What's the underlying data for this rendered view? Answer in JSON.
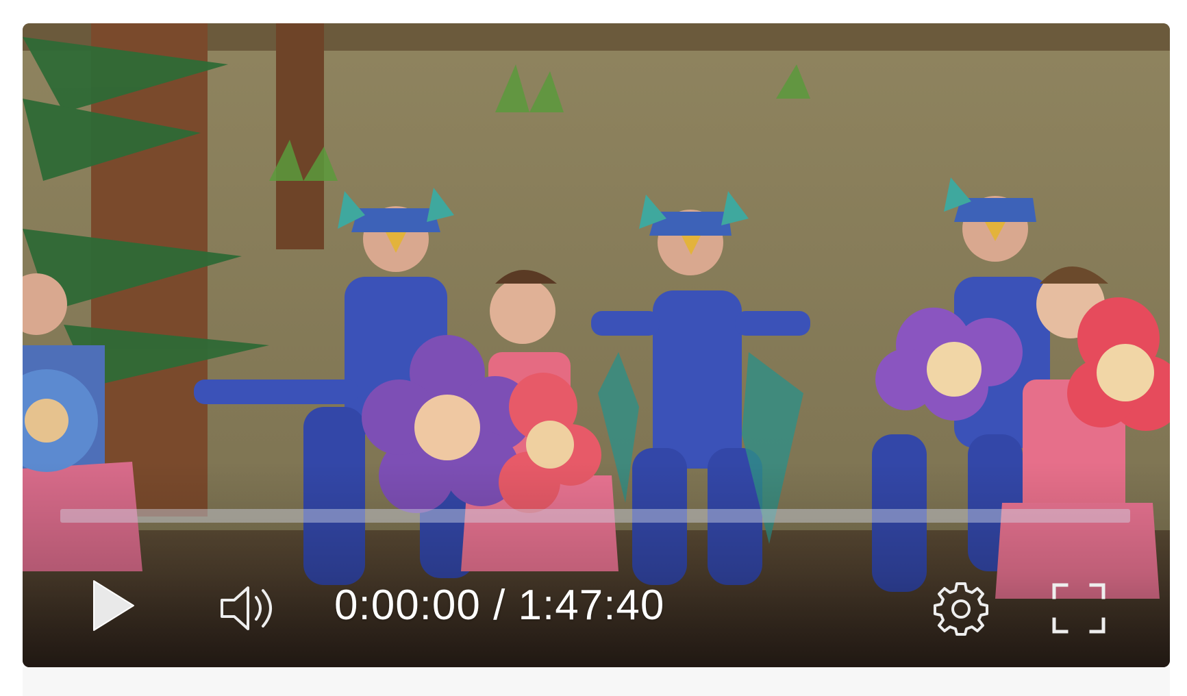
{
  "player": {
    "time_display": "0:00:00 / 1:47:40",
    "progress_fraction": 0,
    "controls": {
      "play": "play-icon",
      "volume": "volume-icon",
      "settings": "gear-icon",
      "fullscreen": "fullscreen-icon"
    },
    "colors": {
      "progress_track": "#d2d7e6",
      "control_foreground": "#ffffff"
    }
  }
}
